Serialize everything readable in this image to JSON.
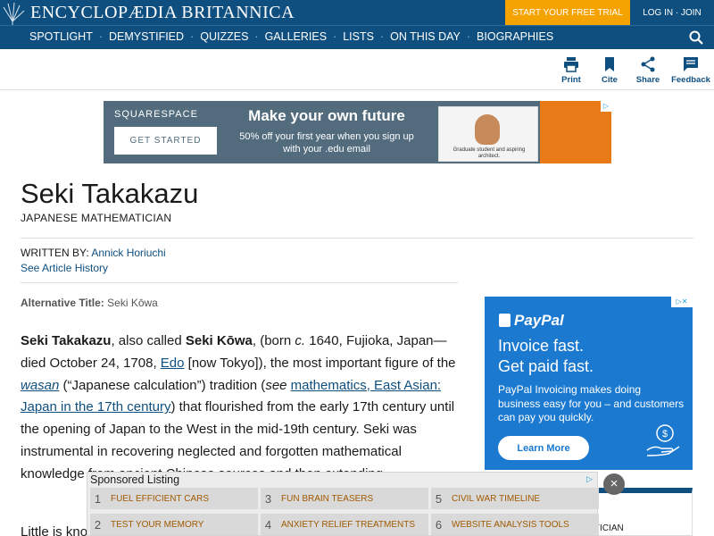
{
  "header": {
    "brand": "ENCYCLOPÆDIA BRITANNICA",
    "trial_label": "START YOUR FREE TRIAL",
    "login_label": "LOG IN · JOIN",
    "nav": [
      "SPOTLIGHT",
      "DEMYSTIFIED",
      "QUIZZES",
      "GALLERIES",
      "LISTS",
      "ON THIS DAY",
      "BIOGRAPHIES"
    ],
    "nav_separator": "·",
    "search_icon": "search-icon",
    "brand_color": "#0f4f7f",
    "accent_color": "#f5a300"
  },
  "toolbar": {
    "print": "Print",
    "cite": "Cite",
    "share": "Share",
    "feedback": "Feedback"
  },
  "ad_top": {
    "logo": "SQUARESPACE",
    "button": "GET STARTED",
    "headline": "Make your own future",
    "subline": "50% off your first year when you sign up with your .edu email",
    "photo_caption": "Graduate student and aspiring architect."
  },
  "article": {
    "title": "Seki Takakazu",
    "subtitle": "JAPANESE MATHEMATICIAN",
    "written_by_label": "WRITTEN BY:",
    "author": "Annick Horiuchi",
    "history_link": "See Article History",
    "alt_title_label": "Alternative Title:",
    "alt_title_value": "Seki Kōwa",
    "p1": {
      "name": "Seki Takakazu",
      "t1": ", also called ",
      "alt": "Seki Kōwa",
      "t2": ", (born ",
      "circa": "c.",
      "t3": " 1640, Fujioka, Japan—died October 24, 1708, ",
      "edo": "Edo",
      "t4": " [now Tokyo]), the most important figure of the ",
      "wasan": "wasan",
      "t5": " (“Japanese calculation”) tradition (",
      "see": "see",
      "t6": " ",
      "math_link": "mathematics, East Asian: Japan in the 17th century",
      "t7": ") that flourished from the early 17th century until the opening of Japan to the West in the mid-19th century. Seki was instrumental in recovering neglected and forgotten mathematical knowledge from ancient Chinese sources and then extending"
    },
    "p2_start": "Little is kno"
  },
  "ad_right": {
    "logo": "PayPal",
    "headline_1": "Invoice fast.",
    "headline_2": "Get paid fast.",
    "body": "PayPal Invoicing makes doing business easy for you – and customers can pay you quickly.",
    "button": "Learn More",
    "brand_color": "#1b79cf"
  },
  "sidebox": {
    "text": "ATICIAN"
  },
  "sponsored": {
    "title": "Sponsored Listing",
    "items": [
      {
        "num": "1",
        "label": "FUEL EFFICIENT CARS"
      },
      {
        "num": "3",
        "label": "FUN BRAIN TEASERS"
      },
      {
        "num": "5",
        "label": "CIVIL WAR TIMELINE"
      },
      {
        "num": "2",
        "label": "TEST YOUR MEMORY"
      },
      {
        "num": "4",
        "label": "ANXIETY RELIEF TREATMENTS"
      },
      {
        "num": "6",
        "label": "WEBSITE ANALYSIS TOOLS"
      }
    ],
    "close": "×"
  }
}
